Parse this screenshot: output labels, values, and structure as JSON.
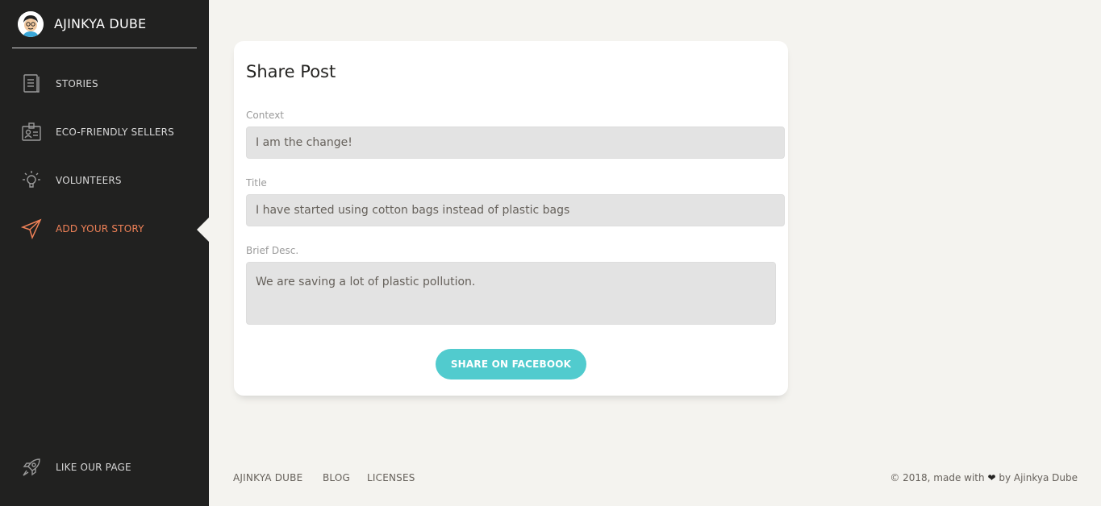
{
  "brand": {
    "name": "AJINKYA DUBE"
  },
  "sidebar": {
    "items": [
      {
        "label": "STORIES",
        "icon": "book-icon"
      },
      {
        "label": "ECO-FRIENDLY SELLERS",
        "icon": "id-card-icon"
      },
      {
        "label": "VOLUNTEERS",
        "icon": "lightbulb-icon"
      },
      {
        "label": "ADD YOUR STORY",
        "icon": "paper-plane-icon",
        "active": true
      },
      {
        "label": "LIKE OUR PAGE",
        "icon": "rocket-icon"
      }
    ]
  },
  "card": {
    "title": "Share Post",
    "context_label": "Context",
    "context_value": "I am the change!",
    "title_label": "Title",
    "title_value": "I have started using cotton bags instead of plastic bags",
    "desc_label": "Brief Desc.",
    "desc_value": "We are saving a lot of plastic pollution.",
    "share_button": "SHARE ON FACEBOOK"
  },
  "footer": {
    "links": [
      "AJINKYA DUBE",
      "BLOG",
      "LICENSES"
    ],
    "copyright_prefix": "© 2018, made with",
    "copyright_suffix": "by Ajinkya Dube",
    "heart_icon": "heart-icon"
  },
  "colors": {
    "sidebar_bg": "#212120",
    "accent": "#ef8157",
    "button": "#51cbce",
    "page_bg": "#f4f3ef"
  }
}
